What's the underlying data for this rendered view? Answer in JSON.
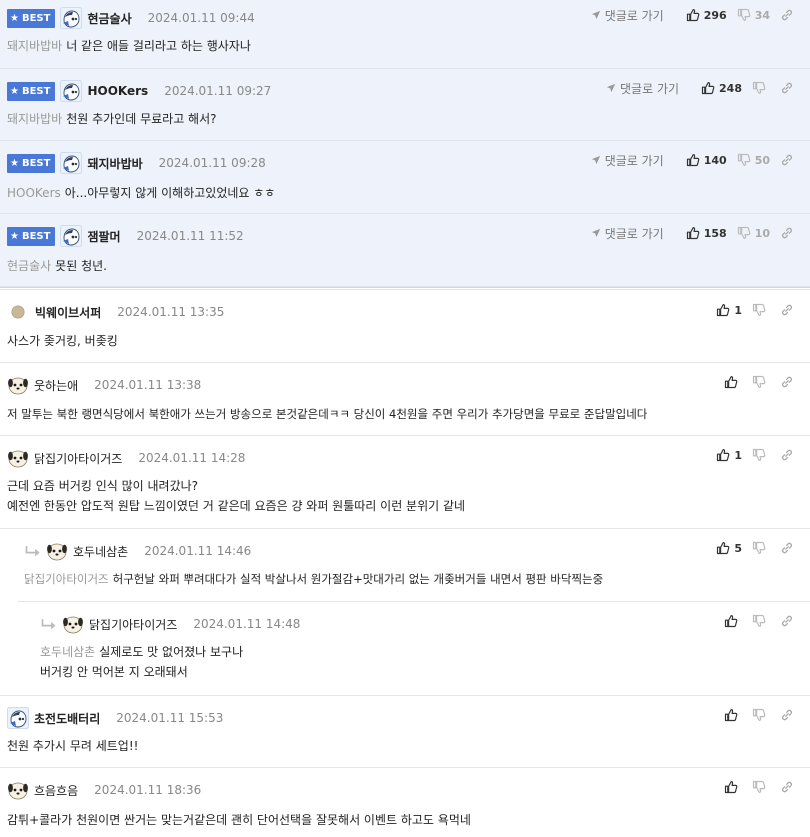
{
  "common": {
    "best_label": "BEST",
    "reply_link_label": "댓글로 가기"
  },
  "best_comments": [
    {
      "nick": "현금술사",
      "date": "2024.01.11 09:44",
      "mention": "돼지바밥바",
      "text": "너 같은 애들 걸리라고 하는 행사자나",
      "up": "296",
      "down": "34",
      "avatar": "robot-avatar"
    },
    {
      "nick": "HOOKers",
      "date": "2024.01.11 09:27",
      "mention": "돼지바밥바",
      "text": "천원 추가인데 무료라고 해서?",
      "up": "248",
      "down": "",
      "avatar": "robot-avatar"
    },
    {
      "nick": "돼지바밥바",
      "date": "2024.01.11 09:28",
      "mention": "HOOKers",
      "text": "아...아무렇지 않게 이해하고있었네요 ㅎㅎ",
      "up": "140",
      "down": "50",
      "avatar": "robot-avatar"
    },
    {
      "nick": "잼팔머",
      "date": "2024.01.11 11:52",
      "mention": "현금술사",
      "text": "못된 청년.",
      "up": "158",
      "down": "10",
      "avatar": "robot-avatar"
    }
  ],
  "comments": [
    {
      "nick": "빅웨이브서퍼",
      "date": "2024.01.11 13:35",
      "lines": [
        "사스가 좆거킹, 버좆킹"
      ],
      "up": "1",
      "avatar": "circle-avatar"
    },
    {
      "nick": "웃하는애",
      "date": "2024.01.11 13:38",
      "lines": [
        "저 말투는 북한 랭면식당에서 북한애가 쓰는거 방송으로 본것같은데ㅋㅋ 당신이 4천원을 주면 우리가 추가당면을 무료로 준답말입네다"
      ],
      "up": "",
      "avatar": "dog-avatar"
    },
    {
      "nick": "닭집기아타이거즈",
      "date": "2024.01.11 14:28",
      "lines": [
        "근데 요즘 버거킹 인식 많이 내려갔나?",
        "예전엔 한동안 압도적 원탑 느낌이였던 거 같은데 요즘은 걍 와퍼 원툴따리 이런 분위기 같네"
      ],
      "up": "1",
      "avatar": "dog-avatar"
    },
    {
      "nick": "호두네삼촌",
      "date": "2024.01.11 14:46",
      "mention": "닭집기아타이거즈",
      "lines": [
        "허구헌날 와퍼 뿌려대다가 실적 박살나서 원가절감+맛대가리 없는 개좆버거들 내면서 평판 바닥찍는중"
      ],
      "up": "5",
      "avatar": "dog-avatar"
    },
    {
      "nick": "닭집기아타이거즈",
      "date": "2024.01.11 14:48",
      "mention": "호두네삼촌",
      "lines": [
        "실제로도 맛 없어졌나 보구나",
        "버거킹 안 먹어본 지 오래돼서"
      ],
      "up": "",
      "avatar": "dog-avatar"
    },
    {
      "nick": "초전도배터리",
      "date": "2024.01.11 15:53",
      "lines": [
        "천원 추가시 무려 세트업!!"
      ],
      "up": "",
      "avatar": "robot-avatar"
    },
    {
      "nick": "흐음흐음",
      "date": "2024.01.11 18:36",
      "lines": [
        "감튀+콜라가 천원이면 싼거는 맞는거같은데 괜히 단어선택을 잘못해서 이벤트 하고도 욕먹네"
      ],
      "up": "",
      "avatar": "dog-avatar"
    }
  ],
  "colors": {
    "best_bg": "#eef3fb",
    "badge": "#4a78d6",
    "muted": "#999999"
  }
}
